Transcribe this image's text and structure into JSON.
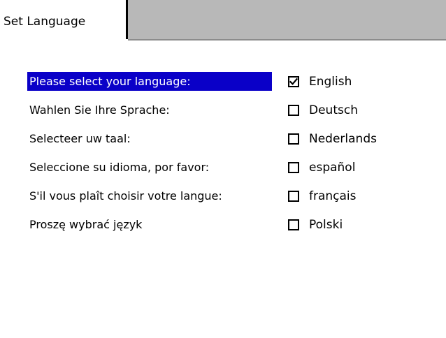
{
  "tab": {
    "title": "Set Language"
  },
  "languages": [
    {
      "prompt": "Please select your language:",
      "option": "English",
      "checked": true,
      "selected": true
    },
    {
      "prompt": "Wahlen Sie Ihre Sprache:",
      "option": "Deutsch",
      "checked": false,
      "selected": false
    },
    {
      "prompt": "Selecteer uw taal:",
      "option": "Nederlands",
      "checked": false,
      "selected": false
    },
    {
      "prompt": "Seleccione su idioma, por favor:",
      "option": "español",
      "checked": false,
      "selected": false
    },
    {
      "prompt": "S'il vous plaît choisir votre langue:",
      "option": "français",
      "checked": false,
      "selected": false
    },
    {
      "prompt": "Proszę wybrać język",
      "option": "Polski",
      "checked": false,
      "selected": false
    }
  ],
  "colors": {
    "selection": "#0a00c8",
    "tabbar": "#b8b8b8"
  }
}
